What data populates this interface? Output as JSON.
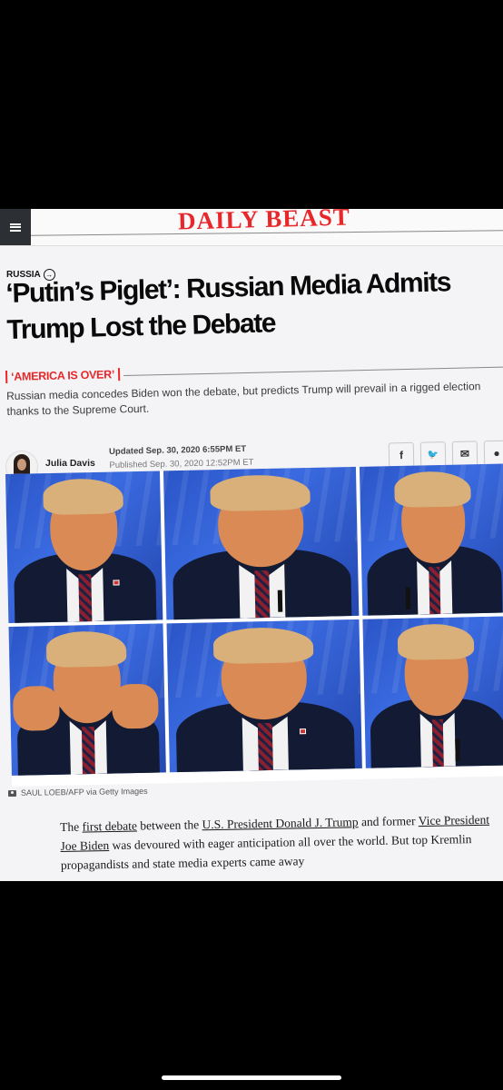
{
  "site": {
    "brand": "DAILY BEAST",
    "menu_icon": "hamburger-menu-icon"
  },
  "article": {
    "section": "RUSSIA",
    "headline": "‘Putin’s Piglet’: Russian Media Admits Trump Lost the Debate",
    "kicker": "‘AMERICA IS OVER’",
    "dek": "Russian media concedes Biden won the debate, but predicts Trump will prevail in a rigged election thanks to the Supreme Court.",
    "author": "Julia Davis",
    "updated": "Updated Sep. 30, 2020 6:55PM ET",
    "published": "Published Sep. 30, 2020 12:52PM ET",
    "share_buttons": [
      {
        "icon": "facebook-icon",
        "glyph": "f"
      },
      {
        "icon": "twitter-icon",
        "glyph": "🐦"
      },
      {
        "icon": "email-icon",
        "glyph": "✉"
      },
      {
        "icon": "reddit-icon",
        "glyph": "●"
      }
    ],
    "photo_credit": "SAUL LOEB/AFP via Getty Images",
    "body": {
      "p1": "The ",
      "link1": "first debate",
      "p2": " between the ",
      "link2": "U.S. President Donald J. Trump",
      "p3": " and former ",
      "link3": "Vice President Joe Biden",
      "p4": " was devoured with eager anticipation all over the world. But top Kremlin propagandists and state media experts came away"
    }
  },
  "colors": {
    "brand_red": "#e8272a",
    "photo_blue": "#2a55c7"
  }
}
